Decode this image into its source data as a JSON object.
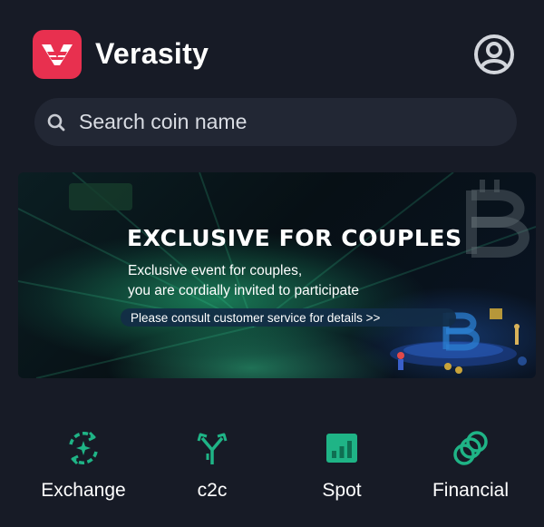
{
  "app": {
    "name": "Verasity",
    "logo_icon": "verasity-v-logo",
    "brand_color": "#e8304f",
    "profile_icon": "user-circle-icon"
  },
  "search": {
    "placeholder": "Search coin name",
    "value": "",
    "icon": "search-icon"
  },
  "banner": {
    "title": "EXCLUSIVE FOR COUPLES",
    "line1": "Exclusive event for couples,",
    "line2": "you are cordially invited to participate",
    "cta": "Please consult customer service for details >>"
  },
  "shortcuts": [
    {
      "label": "Exchange",
      "icon": "exchange-icon"
    },
    {
      "label": "c2c",
      "icon": "c2c-icon"
    },
    {
      "label": "Spot",
      "icon": "spot-chart-icon"
    },
    {
      "label": "Financial",
      "icon": "financial-coins-icon"
    }
  ],
  "colors": {
    "background": "#171b26",
    "search_bg": "#222734",
    "accent_green": "#1fb486"
  }
}
